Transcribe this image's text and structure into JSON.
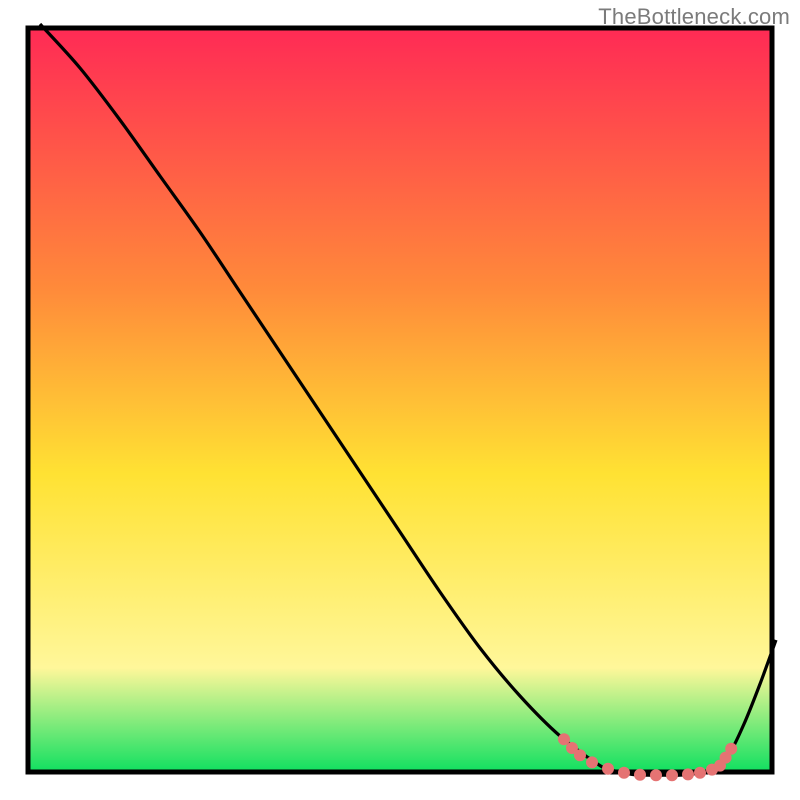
{
  "watermark": "TheBottleneck.com",
  "chart_data": {
    "type": "line",
    "title": "",
    "xlabel": "",
    "ylabel": "",
    "xlim": [
      0,
      100
    ],
    "ylim": [
      0,
      100
    ],
    "background_gradient": {
      "top": "#ff2a55",
      "middle": "#ffe233",
      "bottom": "#10e060"
    },
    "frame": {
      "x": 3.5,
      "y": 3.5,
      "width": 93,
      "height": 93,
      "stroke": "#000000"
    },
    "series": [
      {
        "name": "bottleneck-curve",
        "stroke": "#000000",
        "x": [
          5,
          10,
          15,
          20,
          25,
          30,
          35,
          40,
          45,
          50,
          55,
          60,
          65,
          70,
          75,
          77,
          79,
          81,
          83,
          85,
          87,
          89,
          91,
          93,
          95,
          97
        ],
        "y": [
          97,
          91.5,
          85,
          78,
          71,
          63.5,
          56,
          48.5,
          41,
          33.5,
          26,
          19,
          13,
          8,
          4.3,
          3.6,
          3.2,
          3.1,
          3.1,
          3.1,
          3.3,
          3.8,
          5.5,
          9.5,
          14.5,
          20
        ]
      }
    ],
    "markers": {
      "name": "highlight-dots",
      "fill": "#e57373",
      "radius_px": 6,
      "x": [
        70.5,
        71.5,
        72.5,
        74,
        76,
        78,
        80,
        82,
        84,
        86,
        87.5,
        89,
        90,
        90.7,
        91.4
      ],
      "y": [
        7.6,
        6.5,
        5.6,
        4.7,
        3.9,
        3.4,
        3.15,
        3.1,
        3.1,
        3.2,
        3.4,
        3.8,
        4.3,
        5.3,
        6.4
      ]
    }
  }
}
